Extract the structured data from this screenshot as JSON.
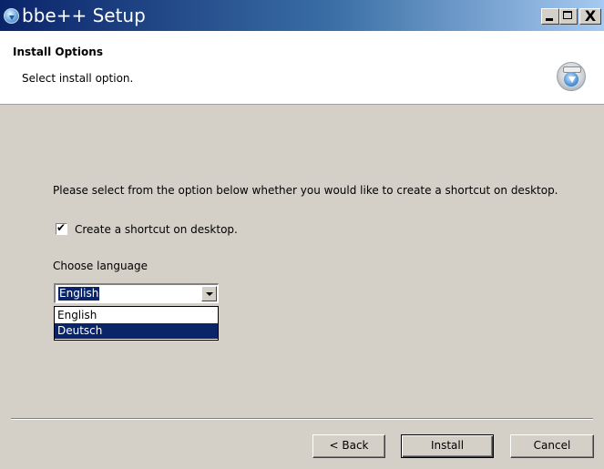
{
  "window": {
    "title": "bbe++ Setup",
    "controls": [
      "minimize-icon",
      "maximize-icon",
      "close-icon"
    ],
    "close_glyph": "X"
  },
  "header": {
    "title": "Install Options",
    "subtitle": "Select install option.",
    "icon": "installer-disc-icon"
  },
  "main": {
    "prompt": "Please select from the option below whether you would like to create a shortcut on desktop.",
    "shortcut_checkbox": {
      "label": "Create a shortcut on desktop.",
      "checked": true,
      "check_glyph": "✔"
    },
    "language": {
      "label": "Choose language",
      "selected": "English",
      "options": [
        "English",
        "Deutsch"
      ],
      "highlighted_option": "Deutsch"
    }
  },
  "footer": {
    "back_label": "< Back",
    "install_label": "Install",
    "cancel_label": "Cancel"
  },
  "colors": {
    "titlebar_start": "#0a246a",
    "titlebar_end": "#a6caf0",
    "dialog_face": "#d4d0c8",
    "selection": "#0a246a"
  }
}
